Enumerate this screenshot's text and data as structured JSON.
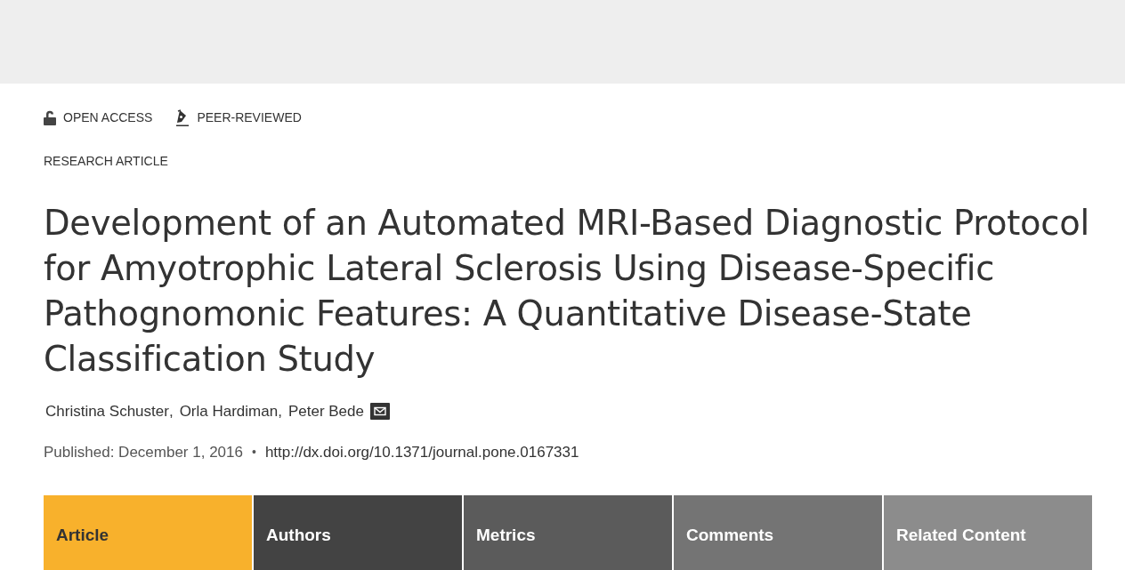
{
  "badges": [
    {
      "kind": "open-access",
      "label": "OPEN ACCESS"
    },
    {
      "kind": "peer-reviewed",
      "label": "PEER-REVIEWED"
    }
  ],
  "article_type": "RESEARCH ARTICLE",
  "title": "Development of an Automated MRI-Based Diagnostic Protocol for Amyotrophic Lateral Sclerosis Using Disease-Specific Pathognomonic Features: A Quantitative Disease-State Classification Study",
  "authors": [
    {
      "name": "Christina Schuster",
      "separator": ","
    },
    {
      "name": "Orla Hardiman",
      "separator": ","
    },
    {
      "name": "Peter Bede",
      "corresponding": true
    }
  ],
  "published": {
    "label": "Published: December 1, 2016",
    "separator": "•",
    "doi": "http://dx.doi.org/10.1371/journal.pone.0167331"
  },
  "tabs": [
    {
      "label": "Article",
      "selected": true,
      "color": "#f8b12c"
    },
    {
      "label": "Authors",
      "selected": false,
      "color": "#434343"
    },
    {
      "label": "Metrics",
      "selected": false,
      "color": "#5b5b5b"
    },
    {
      "label": "Comments",
      "selected": false,
      "color": "#747474"
    },
    {
      "label": "Related Content",
      "selected": false,
      "color": "#8c8c8c"
    }
  ]
}
